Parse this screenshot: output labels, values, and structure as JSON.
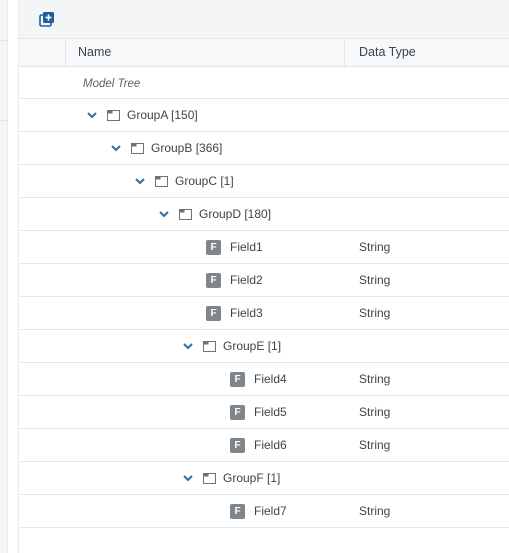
{
  "toolbar": {
    "add_icon": "add-layer-icon"
  },
  "columns": {
    "name": "Name",
    "data_type": "Data Type"
  },
  "tree": {
    "root_label": "Model Tree",
    "rows": [
      {
        "kind": "group",
        "label": "GroupA [150]",
        "type": ""
      },
      {
        "kind": "group",
        "label": "GroupB [366]",
        "type": ""
      },
      {
        "kind": "group",
        "label": "GroupC [1]",
        "type": ""
      },
      {
        "kind": "group",
        "label": "GroupD [180]",
        "type": ""
      },
      {
        "kind": "field",
        "badge": "F",
        "label": "Field1",
        "type": "String"
      },
      {
        "kind": "field",
        "badge": "F",
        "label": "Field2",
        "type": "String"
      },
      {
        "kind": "field",
        "badge": "F",
        "label": "Field3",
        "type": "String"
      },
      {
        "kind": "group",
        "label": "GroupE [1]",
        "type": ""
      },
      {
        "kind": "field",
        "badge": "F",
        "label": "Field4",
        "type": "String"
      },
      {
        "kind": "field",
        "badge": "F",
        "label": "Field5",
        "type": "String"
      },
      {
        "kind": "field",
        "badge": "F",
        "label": "Field6",
        "type": "String"
      },
      {
        "kind": "group",
        "label": "GroupF [1]",
        "type": ""
      },
      {
        "kind": "field",
        "badge": "F",
        "label": "Field7",
        "type": "String"
      }
    ]
  },
  "colors": {
    "chevron": "#2b6ea6",
    "badge": "#7d858d",
    "accent": "#1f5f99"
  }
}
